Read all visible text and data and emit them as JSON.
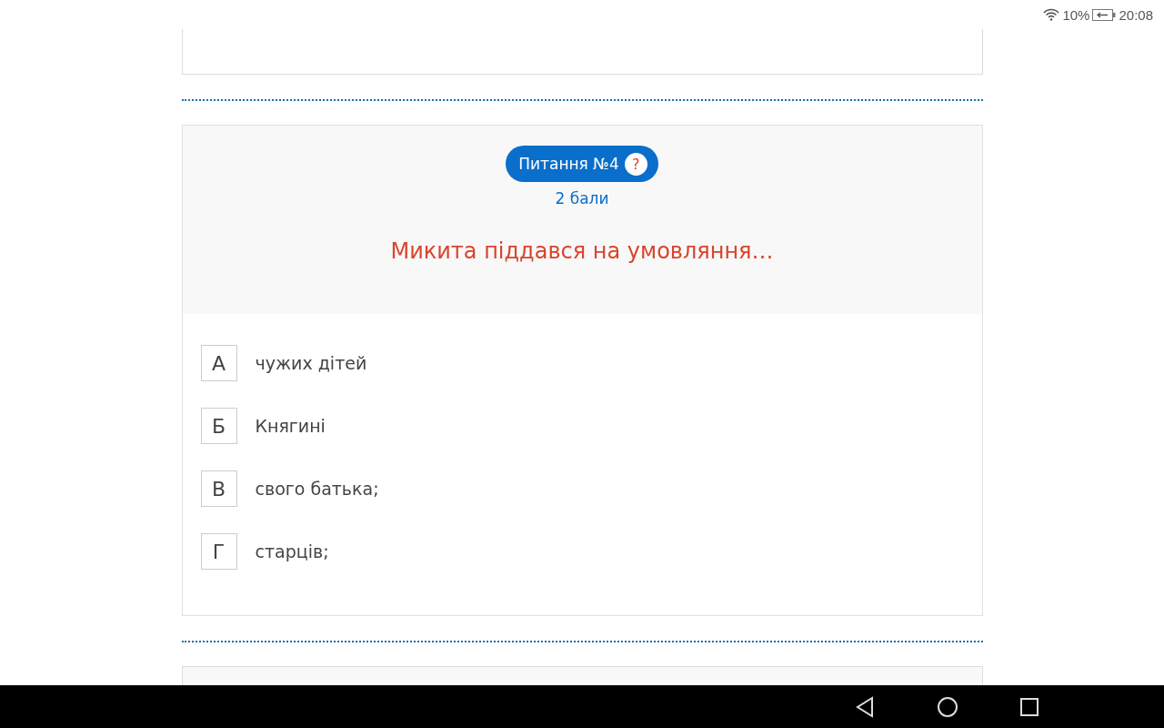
{
  "status_bar": {
    "battery": "10%",
    "time": "20:08"
  },
  "question": {
    "title": "Питання №4",
    "help": "?",
    "points": "2 бали",
    "text": "Микита піддався на умовляння…",
    "options": [
      {
        "letter": "А",
        "text": "чужих дітей"
      },
      {
        "letter": "Б",
        "text": "Княгині"
      },
      {
        "letter": "В",
        "text": "свого батька;"
      },
      {
        "letter": "Г",
        "text": "старців;"
      }
    ]
  }
}
